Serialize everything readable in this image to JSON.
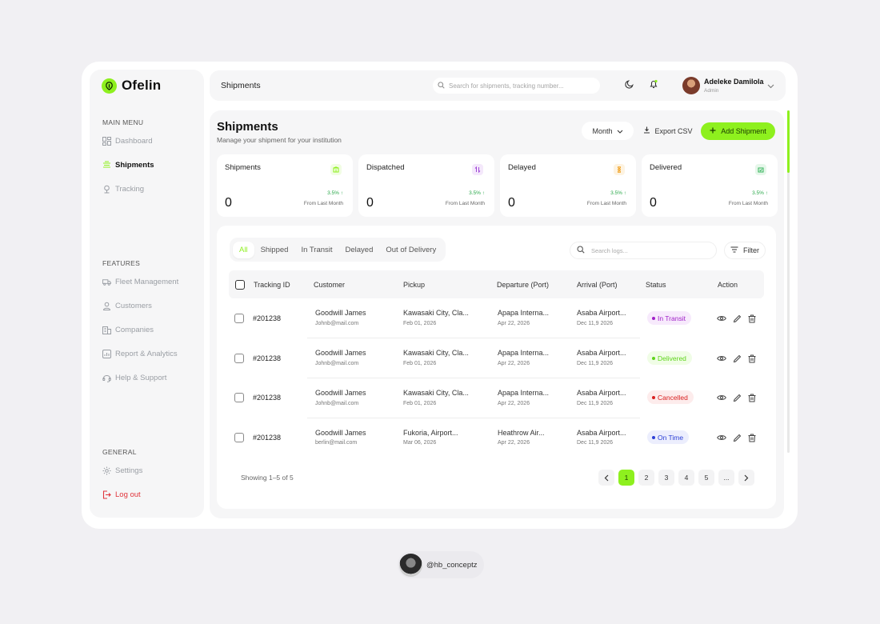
{
  "app": {
    "name": "Ofelin"
  },
  "sidebar": {
    "main_menu_label": "MAIN MENU",
    "main_items": [
      {
        "label": "Dashboard",
        "icon": "dashboard-icon"
      },
      {
        "label": "Shipments",
        "icon": "shipments-icon",
        "active": true
      },
      {
        "label": "Tracking",
        "icon": "tracking-icon"
      }
    ],
    "features_label": "FEATURES",
    "feature_items": [
      {
        "label": "Fleet Management",
        "icon": "truck-icon"
      },
      {
        "label": "Customers",
        "icon": "user-icon"
      },
      {
        "label": "Companies",
        "icon": "building-icon"
      },
      {
        "label": "Report & Analytics",
        "icon": "report-icon"
      },
      {
        "label": "Help & Support",
        "icon": "headset-icon"
      }
    ],
    "general_label": "GENERAL",
    "general_items": [
      {
        "label": "Settings",
        "icon": "gear-icon"
      },
      {
        "label": "Log out",
        "icon": "logout-icon"
      }
    ]
  },
  "topbar": {
    "title": "Shipments",
    "search_placeholder": "Search for shipments, tracking number...",
    "user": {
      "name": "Adeleke Damilola",
      "role": "Admin"
    }
  },
  "page": {
    "title": "Shipments",
    "subtitle": "Manage your shipment for your institution",
    "month_label": "Month",
    "export_label": "Export CSV",
    "add_label": "Add Shipment"
  },
  "stats": [
    {
      "label": "Shipments",
      "value": "0",
      "change": "3.5%",
      "note": "From Last Month",
      "icon": "package-icon",
      "icon_color": "#8ef01e",
      "icon_bg": "#f1fde3"
    },
    {
      "label": "Dispatched",
      "value": "0",
      "change": "3.5%",
      "note": "From Last Month",
      "icon": "swap-icon",
      "icon_color": "#a046d8",
      "icon_bg": "#f4e8fb"
    },
    {
      "label": "Delayed",
      "value": "0",
      "change": "3.5%",
      "note": "From Last Month",
      "icon": "hourglass-icon",
      "icon_color": "#f0a020",
      "icon_bg": "#fdf3e2"
    },
    {
      "label": "Delivered",
      "value": "0",
      "change": "3.5%",
      "note": "From Last Month",
      "icon": "delivered-icon",
      "icon_color": "#34b35a",
      "icon_bg": "#e6f7ea"
    }
  ],
  "tabs": [
    "All",
    "Shipped",
    "In Transit",
    "Delayed",
    "Out of Delivery"
  ],
  "log_search_placeholder": "Search logs...",
  "filter_label": "Filter",
  "table": {
    "headers": [
      "Tracking ID",
      "Customer",
      "Pickup",
      "Departure (Port)",
      "Arrival (Port)",
      "Status",
      "Action"
    ],
    "rows": [
      {
        "id": "#201238",
        "customer": "Goodwill James",
        "email": "Johnb@mail.com",
        "pickup": "Kawasaki City, Cla...",
        "pickup_date": "Feb 01, 2026",
        "departure": "Apapa Interna...",
        "departure_date": "Apr 22, 2026",
        "arrival": "Asaba Airport...",
        "arrival_date": "Dec 11,9 2026",
        "status": "In Transit",
        "status_color": "#a020c8",
        "status_bg": "#f7eafc"
      },
      {
        "id": "#201238",
        "customer": "Goodwill James",
        "email": "Johnb@mail.com",
        "pickup": "Kawasaki City, Cla...",
        "pickup_date": "Feb 01, 2026",
        "departure": "Apapa Interna...",
        "departure_date": "Apr 22, 2026",
        "arrival": "Asaba Airport...",
        "arrival_date": "Dec 11,9 2026",
        "status": "Delivered",
        "status_color": "#5fd41c",
        "status_bg": "#f0fde6"
      },
      {
        "id": "#201238",
        "customer": "Goodwill James",
        "email": "Johnb@mail.com",
        "pickup": "Kawasaki City, Cla...",
        "pickup_date": "Feb 01, 2026",
        "departure": "Apapa Interna...",
        "departure_date": "Apr 22, 2026",
        "arrival": "Asaba Airport...",
        "arrival_date": "Dec 11,9 2026",
        "status": "Cancelled",
        "status_color": "#d92020",
        "status_bg": "#fdecec"
      },
      {
        "id": "#201238",
        "customer": "Goodwill James",
        "email": "berlin@mail.com",
        "pickup": "Fukoria, Airport...",
        "pickup_date": "Mar 06, 2026",
        "departure": "Heathrow Air...",
        "departure_date": "Apr 22, 2026",
        "arrival": "Asaba Airport...",
        "arrival_date": "Dec 11,9 2026",
        "status": "On Time",
        "status_color": "#2b3fd6",
        "status_bg": "#eceefd"
      }
    ]
  },
  "pagination": {
    "showing": "Showing 1–5 of 5",
    "pages": [
      "1",
      "2",
      "3",
      "4",
      "5",
      "..."
    ]
  },
  "credit": {
    "handle": "@hb_conceptz"
  },
  "colors": {
    "accent": "#8ef01e"
  }
}
